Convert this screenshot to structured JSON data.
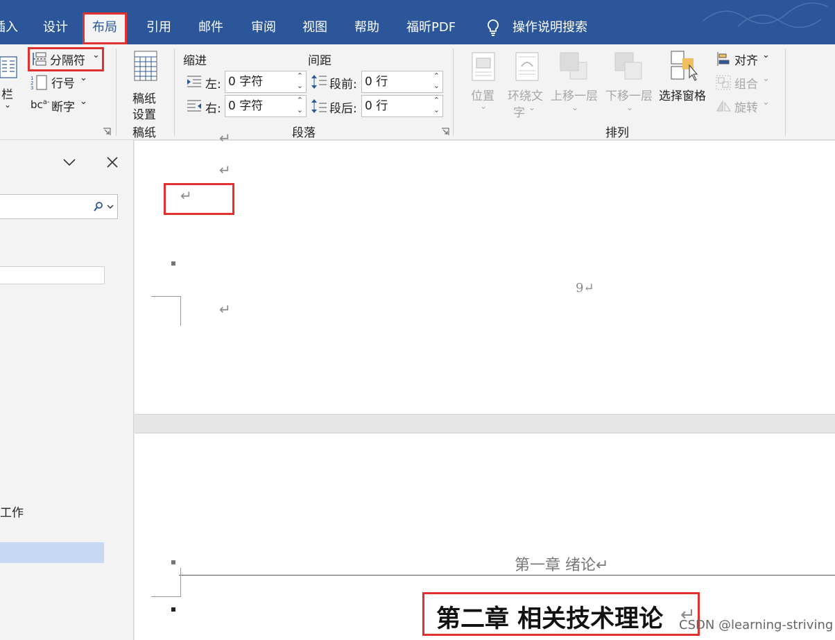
{
  "tabs": [
    {
      "label": "插入",
      "shown": "插入"
    },
    {
      "label": "设计"
    },
    {
      "label": "布局",
      "active": true
    },
    {
      "label": "引用"
    },
    {
      "label": "邮件"
    },
    {
      "label": "审阅"
    },
    {
      "label": "视图"
    },
    {
      "label": "帮助"
    },
    {
      "label": "福昕PDF"
    },
    {
      "label": "操作说明搜索"
    }
  ],
  "ribbon": {
    "page_setup": {
      "columns_label": "栏",
      "breaks_label": "分隔符",
      "line_numbers_label": "行号",
      "hyphenation_label": "断字"
    },
    "manuscript": {
      "button_label_1": "稿纸",
      "button_label_2": "设置",
      "group_label": "稿纸"
    },
    "paragraph": {
      "indent_header": "缩进",
      "spacing_header": "间距",
      "left_label": "左:",
      "left_value": "0 字符",
      "right_label": "右:",
      "right_value": "0 字符",
      "before_label": "段前:",
      "before_value": "0 行",
      "after_label": "段后:",
      "after_value": "0 行",
      "group_label": "段落"
    },
    "arrange": {
      "position_label": "位置",
      "wrap_label_1": "环绕文",
      "wrap_label_2": "字",
      "bring_forward_label": "上移一层",
      "send_backward_label": "下移一层",
      "selection_pane_label": "选择窗格",
      "align_label": "对齐",
      "group_obj_label": "组合",
      "rotate_label": "旋转",
      "group_label": "排列"
    }
  },
  "left_pane": {
    "item_text": "工作"
  },
  "document": {
    "page_number_text": "9↵",
    "para_mark": "↵",
    "header_text": "第一章 绪论↵",
    "heading_text": "第二章  相关技术理论",
    "heading_mark": "↵"
  },
  "watermark": "CSDN @learning-striving",
  "colors": {
    "tab_bar": "#2b579a",
    "ribbon_bg": "#f3f3f3",
    "highlight_box": "#e03030",
    "nav_highlight": "#c6d8f2"
  }
}
